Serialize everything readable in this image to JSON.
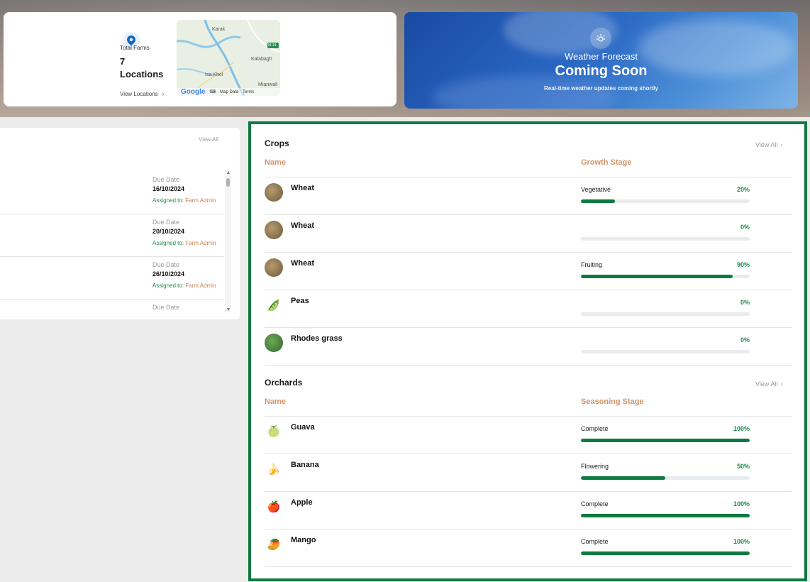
{
  "farms": {
    "label": "Total Farms",
    "count": "7",
    "unit": "Locations",
    "view_link": "View Locations",
    "map": {
      "places": [
        "Karak",
        "Kalabagh",
        "Isa Khel",
        "Mianwali",
        "M-14"
      ],
      "footer": [
        "Google",
        "Map Data",
        "Terms"
      ]
    }
  },
  "weather": {
    "title": "Weather Forecast",
    "headline": "Coming Soon",
    "subtitle": "Real-time weather updates coming shortly"
  },
  "tasks": {
    "view_all": "View All",
    "items": [
      {
        "due_label": "Due Date",
        "due_date": "16/10/2024",
        "assigned_prefix": "Assigned to:",
        "assignee": "Farm Admin"
      },
      {
        "due_label": "Due Date",
        "due_date": "20/10/2024",
        "assigned_prefix": "Assigned to:",
        "assignee": "Farm Admin"
      },
      {
        "due_label": "Due Date",
        "due_date": "26/10/2024",
        "assigned_prefix": "Assigned to:",
        "assignee": "Farm Admin"
      },
      {
        "due_label": "Due Date"
      }
    ]
  },
  "crops": {
    "title": "Crops",
    "view_all": "View All",
    "col_name": "Name",
    "col_stage": "Growth Stage",
    "rows": [
      {
        "name": "Wheat",
        "icon": "wheat-icon",
        "stage": "Vegetative",
        "pct_label": "20%",
        "progress": 0.2
      },
      {
        "name": "Wheat",
        "icon": "wheat-icon",
        "stage": "",
        "pct_label": "0%",
        "progress": 0
      },
      {
        "name": "Wheat",
        "icon": "wheat-icon",
        "stage": "Fruiting",
        "pct_label": "90%",
        "progress": 0.9
      },
      {
        "name": "Peas",
        "icon": "peas-icon",
        "stage": "",
        "pct_label": "0%",
        "progress": 0
      },
      {
        "name": "Rhodes grass",
        "icon": "grass-icon",
        "stage": "",
        "pct_label": "0%",
        "progress": 0
      }
    ]
  },
  "orchards": {
    "title": "Orchards",
    "view_all": "View All",
    "col_name": "Name",
    "col_stage": "Seasoning Stage",
    "rows": [
      {
        "name": "Guava",
        "icon": "guava-icon",
        "stage": "Complete",
        "pct_label": "100%",
        "progress": 1.0
      },
      {
        "name": "Banana",
        "icon": "banana-icon",
        "stage": "Flowering",
        "pct_label": "50%",
        "progress": 0.5
      },
      {
        "name": "Apple",
        "icon": "apple-icon",
        "stage": "Complete",
        "pct_label": "100%",
        "progress": 1.0
      },
      {
        "name": "Mango",
        "icon": "mango-icon",
        "stage": "Complete",
        "pct_label": "100%",
        "progress": 1.0
      }
    ]
  },
  "colors": {
    "accent_green": "#0f7a3f",
    "header_orange": "#d2956a",
    "weather_blue": "#2a68c4"
  }
}
